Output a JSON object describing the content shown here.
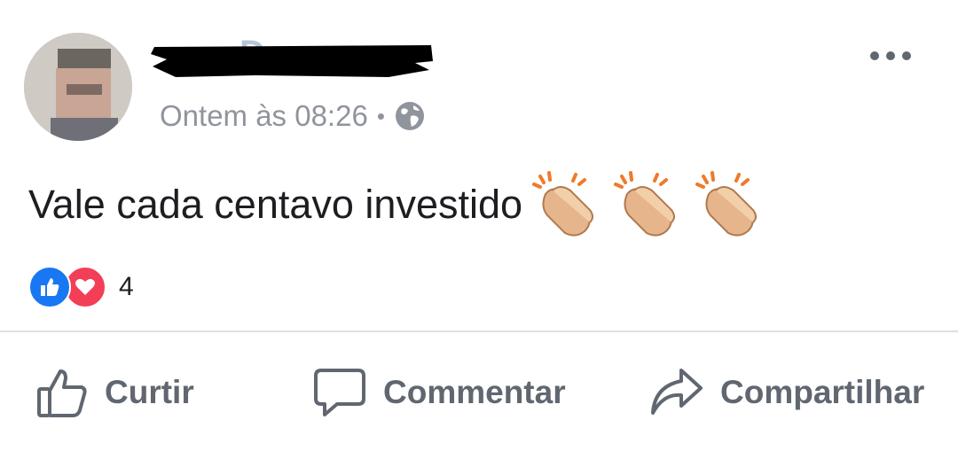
{
  "post": {
    "author_avatar_icon": "avatar-photo",
    "timestamp": "Ontem às 08:26",
    "separator": "•",
    "audience_icon": "globe-icon",
    "text": "Vale cada centavo investido",
    "emoji_icons": [
      "clapping-hands-icon",
      "clapping-hands-icon",
      "clapping-hands-icon"
    ]
  },
  "reactions": {
    "icons": [
      "like-icon",
      "love-icon"
    ],
    "count": "4"
  },
  "actions": [
    {
      "label": "Curtir",
      "icon": "thumbs-up-icon"
    },
    {
      "label": "Commentar",
      "icon": "comment-icon"
    },
    {
      "label": "Compartilhar",
      "icon": "share-icon"
    }
  ],
  "colors": {
    "meta_gray": "#90949c",
    "action_gray": "#606770",
    "like_blue": "#1877f2",
    "love_red": "#f33e58",
    "divider": "#dddfe2"
  }
}
